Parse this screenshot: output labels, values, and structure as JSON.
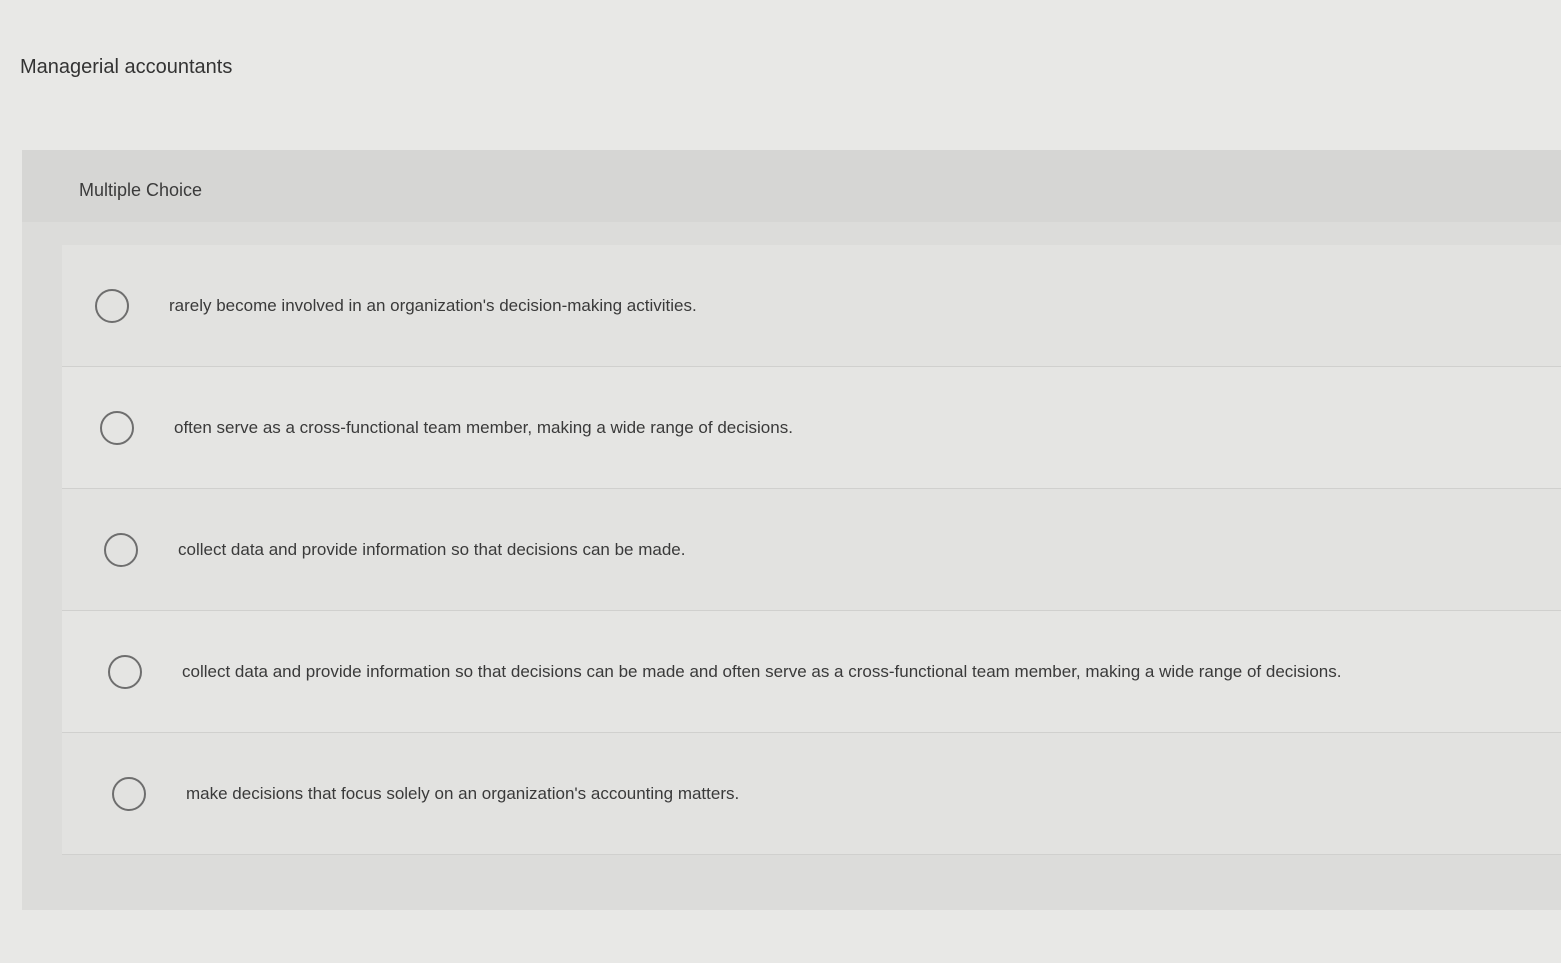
{
  "question": {
    "stem": "Managerial accountants",
    "type_label": "Multiple Choice",
    "options": [
      {
        "text": "rarely become involved in an organization's decision-making activities."
      },
      {
        "text": "often serve as a cross-functional team member, making a wide range of decisions."
      },
      {
        "text": "collect data and provide information so that decisions can be made."
      },
      {
        "text": "collect data and provide information so that decisions can be made and often serve as a cross-functional team member, making a wide range of decisions."
      },
      {
        "text": "make decisions that focus solely on an organization's accounting matters."
      }
    ]
  },
  "colors": {
    "background": "#e8e8e6",
    "panel": "#dcdcda",
    "radio_border": "#6e6e6e",
    "text": "#3a3a3a"
  }
}
